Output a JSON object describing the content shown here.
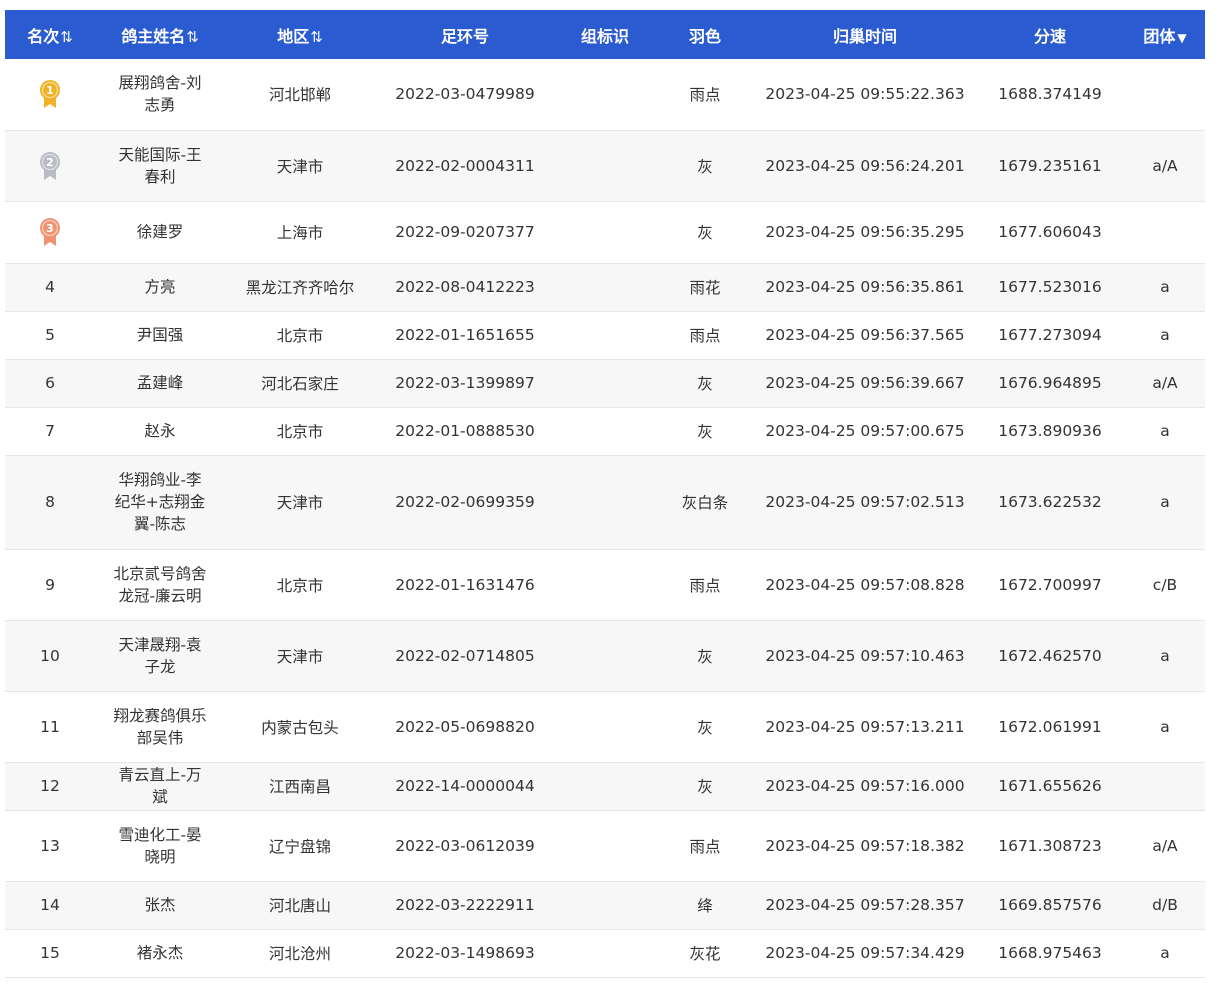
{
  "headers": {
    "rank": "名次",
    "owner": "鸽主姓名",
    "region": "地区",
    "ring": "足环号",
    "group_id": "组标识",
    "color": "羽色",
    "return_time": "归巢时间",
    "speed": "分速",
    "team": "团体"
  },
  "medal_colors": {
    "gold": "#f0b325",
    "silver": "#b9bcc4",
    "bronze": "#ee9473"
  },
  "rows": [
    {
      "rank": "1",
      "owner": "展翔鸽舍-刘志勇",
      "region": "河北邯郸",
      "ring": "2022-03-0479989",
      "group_id": "",
      "color": "雨点",
      "time": "2023-04-25 09:55:22.363",
      "speed": "1688.374149",
      "team": ""
    },
    {
      "rank": "2",
      "owner": "天能国际-王春利",
      "region": "天津市",
      "ring": "2022-02-0004311",
      "group_id": "",
      "color": "灰",
      "time": "2023-04-25 09:56:24.201",
      "speed": "1679.235161",
      "team": "a/A"
    },
    {
      "rank": "3",
      "owner": "徐建罗",
      "region": "上海市",
      "ring": "2022-09-0207377",
      "group_id": "",
      "color": "灰",
      "time": "2023-04-25 09:56:35.295",
      "speed": "1677.606043",
      "team": ""
    },
    {
      "rank": "4",
      "owner": "方亮",
      "region": "黑龙江齐齐哈尔",
      "ring": "2022-08-0412223",
      "group_id": "",
      "color": "雨花",
      "time": "2023-04-25 09:56:35.861",
      "speed": "1677.523016",
      "team": "a"
    },
    {
      "rank": "5",
      "owner": "尹国强",
      "region": "北京市",
      "ring": "2022-01-1651655",
      "group_id": "",
      "color": "雨点",
      "time": "2023-04-25 09:56:37.565",
      "speed": "1677.273094",
      "team": "a"
    },
    {
      "rank": "6",
      "owner": "孟建峰",
      "region": "河北石家庄",
      "ring": "2022-03-1399897",
      "group_id": "",
      "color": "灰",
      "time": "2023-04-25 09:56:39.667",
      "speed": "1676.964895",
      "team": "a/A"
    },
    {
      "rank": "7",
      "owner": "赵永",
      "region": "北京市",
      "ring": "2022-01-0888530",
      "group_id": "",
      "color": "灰",
      "time": "2023-04-25 09:57:00.675",
      "speed": "1673.890936",
      "team": "a"
    },
    {
      "rank": "8",
      "owner": "华翔鸽业-李纪华+志翔金翼-陈志",
      "region": "天津市",
      "ring": "2022-02-0699359",
      "group_id": "",
      "color": "灰白条",
      "time": "2023-04-25 09:57:02.513",
      "speed": "1673.622532",
      "team": "a"
    },
    {
      "rank": "9",
      "owner": "北京贰号鸽舍龙冠-廉云明",
      "region": "北京市",
      "ring": "2022-01-1631476",
      "group_id": "",
      "color": "雨点",
      "time": "2023-04-25 09:57:08.828",
      "speed": "1672.700997",
      "team": "c/B"
    },
    {
      "rank": "10",
      "owner": "天津晟翔-袁子龙",
      "region": "天津市",
      "ring": "2022-02-0714805",
      "group_id": "",
      "color": "灰",
      "time": "2023-04-25 09:57:10.463",
      "speed": "1672.462570",
      "team": "a"
    },
    {
      "rank": "11",
      "owner": "翔龙赛鸽俱乐部吴伟",
      "region": "内蒙古包头",
      "ring": "2022-05-0698820",
      "group_id": "",
      "color": "灰",
      "time": "2023-04-25 09:57:13.211",
      "speed": "1672.061991",
      "team": "a"
    },
    {
      "rank": "12",
      "owner": "青云直上-万斌",
      "region": "江西南昌",
      "ring": "2022-14-0000044",
      "group_id": "",
      "color": "灰",
      "time": "2023-04-25 09:57:16.000",
      "speed": "1671.655626",
      "team": ""
    },
    {
      "rank": "13",
      "owner": "雪迪化工-晏晓明",
      "region": "辽宁盘锦",
      "ring": "2022-03-0612039",
      "group_id": "",
      "color": "雨点",
      "time": "2023-04-25 09:57:18.382",
      "speed": "1671.308723",
      "team": "a/A"
    },
    {
      "rank": "14",
      "owner": "张杰",
      "region": "河北唐山",
      "ring": "2022-03-2222911",
      "group_id": "",
      "color": "绛",
      "time": "2023-04-25 09:57:28.357",
      "speed": "1669.857576",
      "team": "d/B"
    },
    {
      "rank": "15",
      "owner": "褚永杰",
      "region": "河北沧州",
      "ring": "2022-03-1498693",
      "group_id": "",
      "color": "灰花",
      "time": "2023-04-25 09:57:34.429",
      "speed": "1668.975463",
      "team": "a"
    }
  ]
}
